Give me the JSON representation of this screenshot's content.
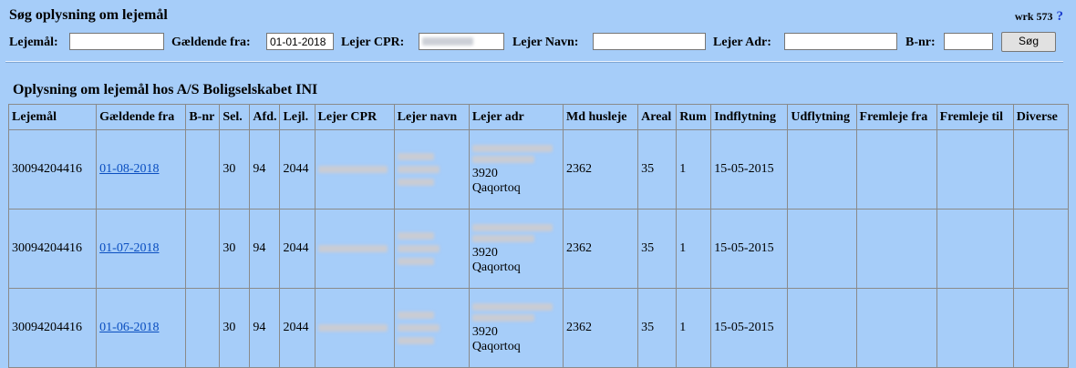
{
  "header": {
    "title": "Søg oplysning om lejemål",
    "wrk": "wrk 573",
    "help": "?"
  },
  "form": {
    "lejemaal_label": "Lejemål:",
    "lejemaal_value": "",
    "gaeldende_label": "Gældende fra:",
    "gaeldende_value": "01-01-2018",
    "cpr_label": "Lejer CPR:",
    "navn_label": "Lejer Navn:",
    "navn_value": "",
    "adr_label": "Lejer Adr:",
    "adr_value": "",
    "bnr_label": "B-nr:",
    "bnr_value": "",
    "search_button": "Søg"
  },
  "results": {
    "heading": "Oplysning om lejemål hos A/S Boligselskabet INI",
    "columns": [
      "Lejemål",
      "Gældende fra",
      "B-nr",
      "Sel.",
      "Afd.",
      "Lejl.",
      "Lejer CPR",
      "Lejer navn",
      "Lejer adr",
      "Md husleje",
      "Areal",
      "Rum",
      "Indflytning",
      "Udflytning",
      "Fremleje fra",
      "Fremleje til",
      "Diverse"
    ],
    "rows": [
      {
        "lejemaal": "30094204416",
        "gaeldende": "01-08-2018",
        "bnr": "",
        "sel": "30",
        "afd": "94",
        "lejl": "2044",
        "postnr": "3920",
        "by": "Qaqortoq",
        "husleje": "2362",
        "areal": "35",
        "rum": "1",
        "indflytning": "15-05-2015",
        "udflytning": "",
        "fremleje_fra": "",
        "fremleje_til": "",
        "diverse": ""
      },
      {
        "lejemaal": "30094204416",
        "gaeldende": "01-07-2018",
        "bnr": "",
        "sel": "30",
        "afd": "94",
        "lejl": "2044",
        "postnr": "3920",
        "by": "Qaqortoq",
        "husleje": "2362",
        "areal": "35",
        "rum": "1",
        "indflytning": "15-05-2015",
        "udflytning": "",
        "fremleje_fra": "",
        "fremleje_til": "",
        "diverse": ""
      },
      {
        "lejemaal": "30094204416",
        "gaeldende": "01-06-2018",
        "bnr": "",
        "sel": "30",
        "afd": "94",
        "lejl": "2044",
        "postnr": "3920",
        "by": "Qaqortoq",
        "husleje": "2362",
        "areal": "35",
        "rum": "1",
        "indflytning": "15-05-2015",
        "udflytning": "",
        "fremleje_fra": "",
        "fremleje_til": "",
        "diverse": ""
      }
    ]
  }
}
